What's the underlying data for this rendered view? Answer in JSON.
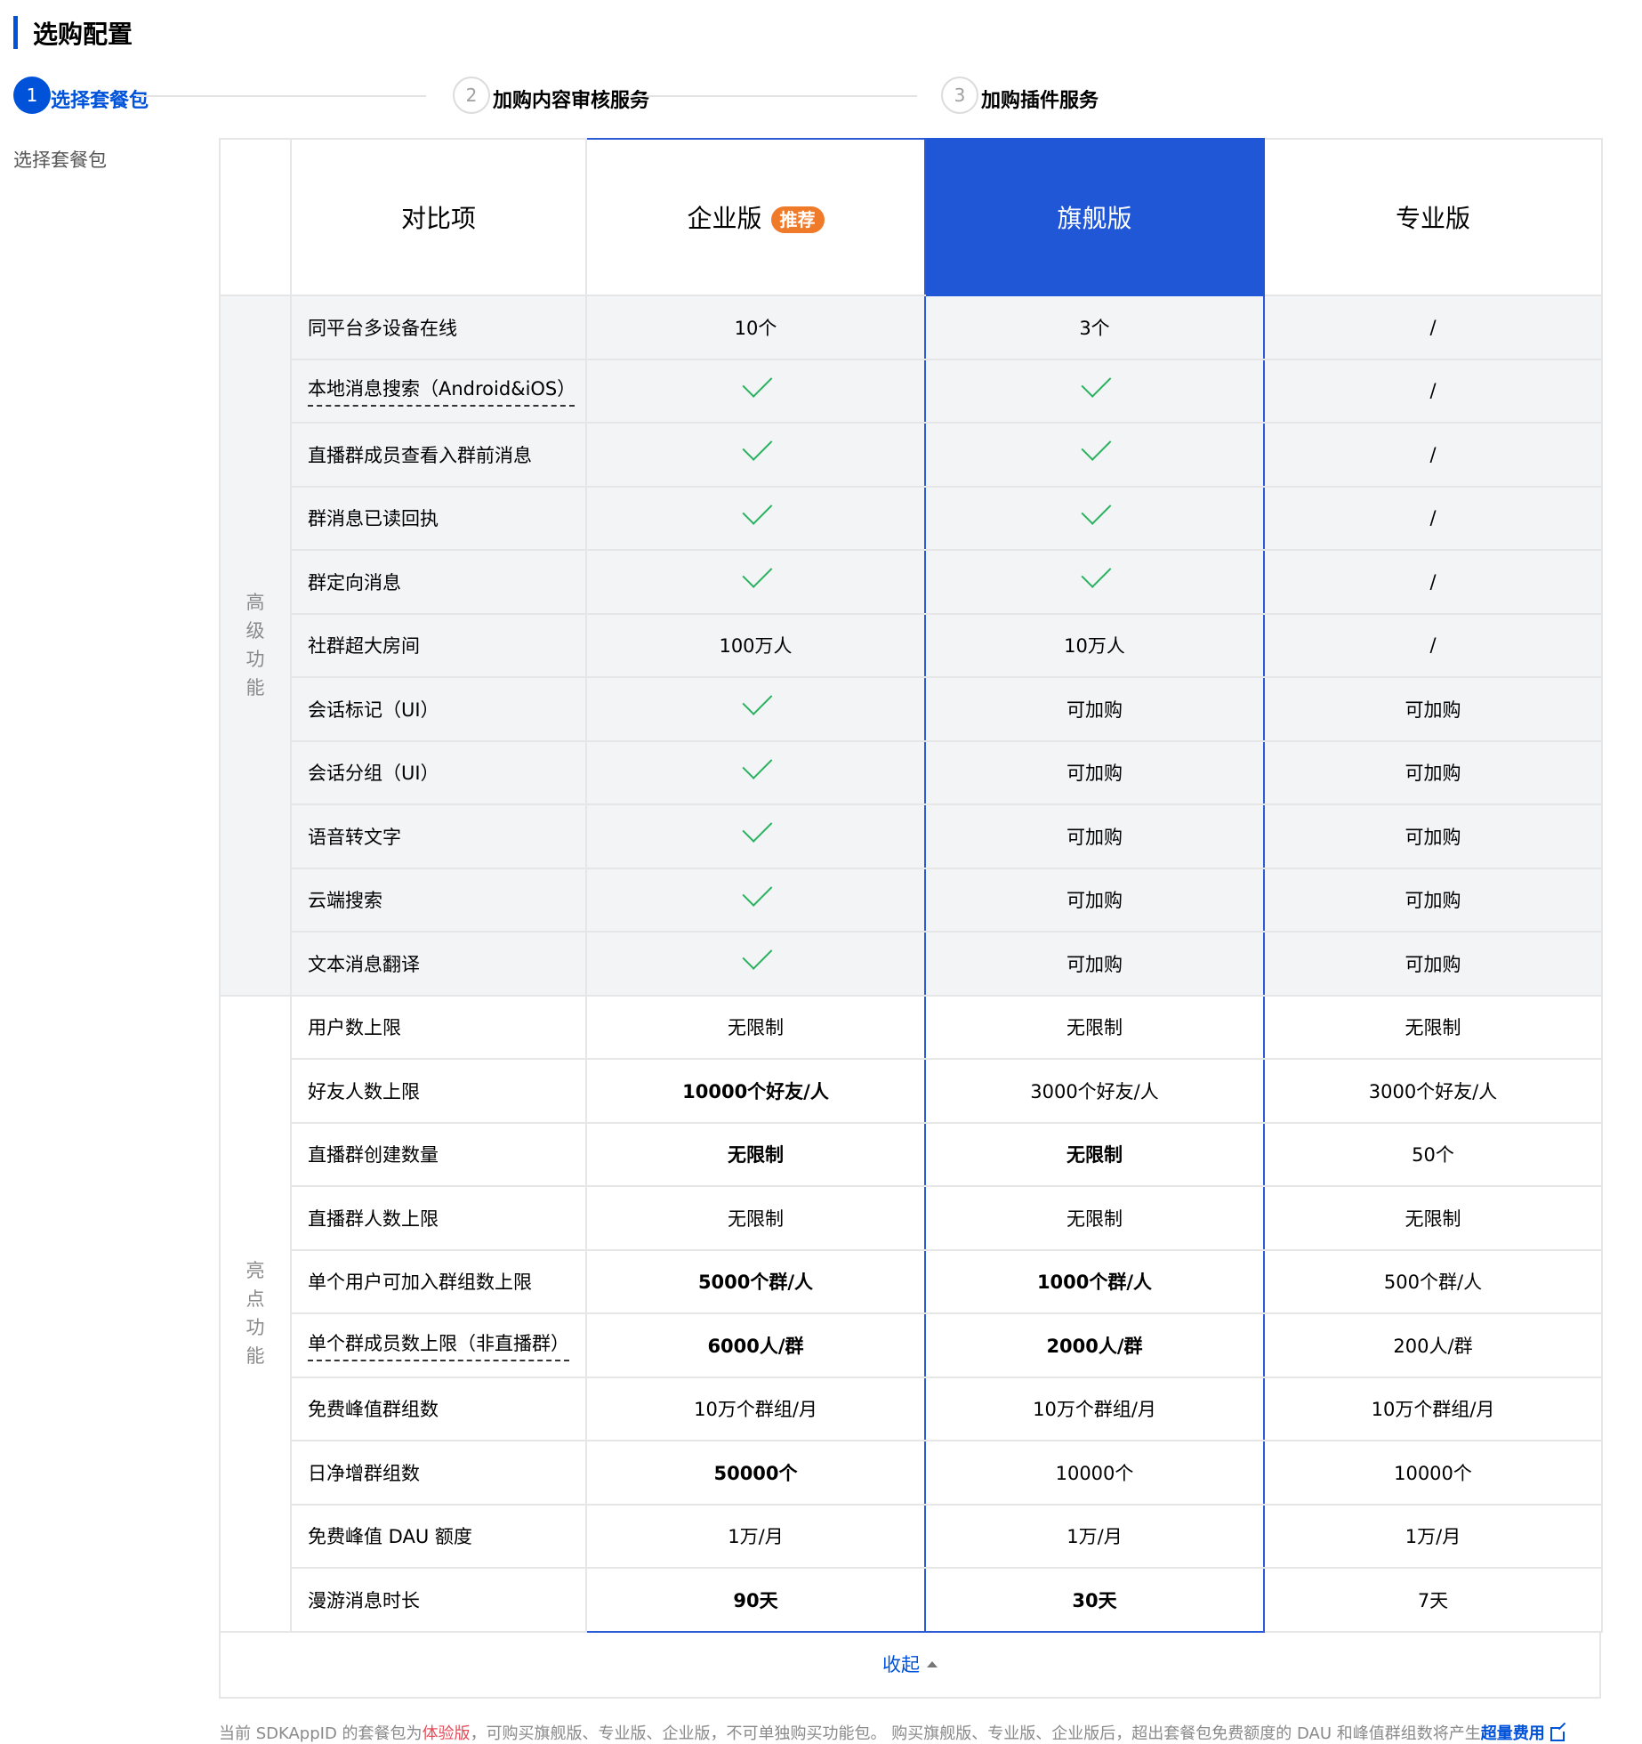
{
  "page_title": "选购配置",
  "steps": [
    {
      "num": "1",
      "label": "选择套餐包"
    },
    {
      "num": "2",
      "label": "加购内容审核服务"
    },
    {
      "num": "3",
      "label": "加购插件服务"
    }
  ],
  "side_label": "选择套餐包",
  "table": {
    "header": {
      "compare": "对比项",
      "enterprise": "企业版",
      "badge": "推荐",
      "flagship": "旗舰版",
      "pro": "专业版"
    },
    "groups": {
      "advanced": "高级功能",
      "highlight": "亮点功能"
    },
    "advanced_rows": [
      {
        "feature": "同平台多设备在线",
        "ent": "10个",
        "flag": "3个",
        "pro": "/"
      },
      {
        "feature": "本地消息搜索（Android&iOS）",
        "ent": "check",
        "flag": "check",
        "pro": "/"
      },
      {
        "feature": "直播群成员查看入群前消息",
        "ent": "check",
        "flag": "check",
        "pro": "/"
      },
      {
        "feature": "群消息已读回执",
        "ent": "check",
        "flag": "check",
        "pro": "/"
      },
      {
        "feature": "群定向消息",
        "ent": "check",
        "flag": "check",
        "pro": "/"
      },
      {
        "feature": "社群超大房间",
        "ent": "100万人",
        "flag": "10万人",
        "pro": "/"
      },
      {
        "feature": "会话标记（UI）",
        "ent": "check",
        "flag": "可加购",
        "pro": "可加购"
      },
      {
        "feature": "会话分组（UI）",
        "ent": "check",
        "flag": "可加购",
        "pro": "可加购"
      },
      {
        "feature": "语音转文字",
        "ent": "check",
        "flag": "可加购",
        "pro": "可加购"
      },
      {
        "feature": "云端搜索",
        "ent": "check",
        "flag": "可加购",
        "pro": "可加购"
      },
      {
        "feature": "文本消息翻译",
        "ent": "check",
        "flag": "可加购",
        "pro": "可加购"
      }
    ],
    "highlight_rows": [
      {
        "feature": "用户数上限",
        "ent": "无限制",
        "flag": "无限制",
        "pro": "无限制"
      },
      {
        "feature": "好友人数上限",
        "ent": "10000个好友/人",
        "flag": "3000个好友/人",
        "pro": "3000个好友/人"
      },
      {
        "feature": "直播群创建数量",
        "ent": "无限制",
        "flag": "无限制",
        "pro": "50个"
      },
      {
        "feature": "直播群人数上限",
        "ent": "无限制",
        "flag": "无限制",
        "pro": "无限制"
      },
      {
        "feature": "单个用户可加入群组数上限",
        "ent": "5000个群/人",
        "flag": "1000个群/人",
        "pro": "500个群/人"
      },
      {
        "feature": "单个群成员数上限（非直播群）",
        "ent": "6000人/群",
        "flag": "2000人/群",
        "pro": "200人/群"
      },
      {
        "feature": "免费峰值群组数",
        "ent": "10万个群组/月",
        "flag": "10万个群组/月",
        "pro": "10万个群组/月"
      },
      {
        "feature": "日净增群组数",
        "ent": "50000个",
        "flag": "10000个",
        "pro": "10000个"
      },
      {
        "feature": "免费峰值 DAU 额度",
        "ent": "1万/月",
        "flag": "1万/月",
        "pro": "1万/月"
      },
      {
        "feature": "漫游消息时长",
        "ent": "90天",
        "flag": "30天",
        "pro": "7天"
      }
    ]
  },
  "collapse_label": "收起",
  "footnote": {
    "prefix": "当前 SDKAppID 的套餐包为",
    "plan": "体验版",
    "middle": "，可购买旗舰版、专业版、企业版，不可单独购买功能包。 购买旗舰版、专业版、企业版后，超出套餐包免费额度的 DAU 和峰值群组数将产生",
    "link": "超量费用"
  }
}
